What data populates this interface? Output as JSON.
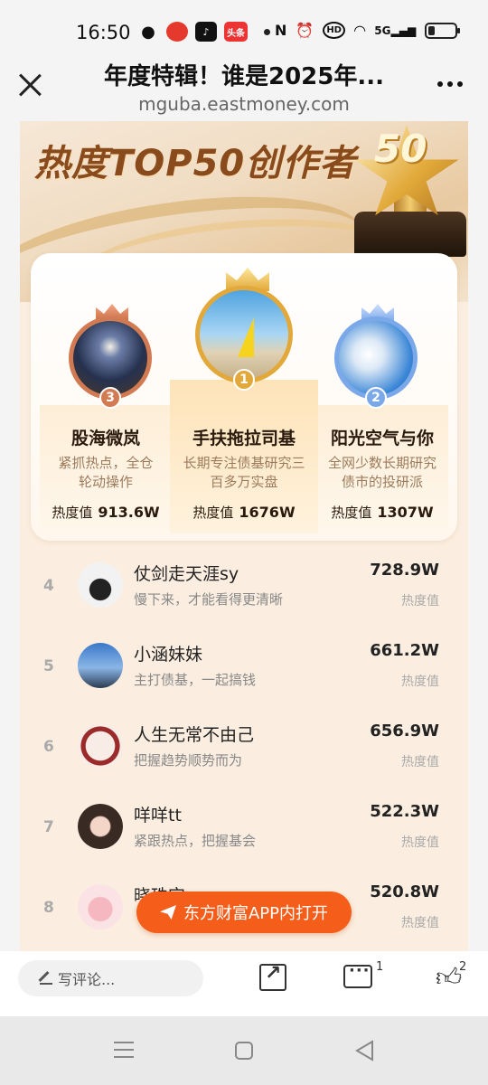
{
  "status_bar": {
    "time": "16:50",
    "toutiao_label": "头条",
    "hd_label": "HD",
    "net_label": "5G",
    "battery_level": 0.25,
    "icons": [
      "wechat-icon",
      "app-icon",
      "tiktok-icon",
      "toutiao-icon",
      "nfc-icon",
      "alarm-icon",
      "hd-icon",
      "wifi-icon",
      "signal-icon",
      "battery-icon"
    ]
  },
  "header": {
    "title": "年度特辑！谁是2025年...",
    "url": "mguba.eastmoney.com"
  },
  "banner": {
    "title": "热度TOP50创作者",
    "trophy_number": "50"
  },
  "podium": [
    {
      "rank": "3",
      "name": "股海微岚",
      "desc": "紧抓热点，全仓轮动操作",
      "heat_label": "热度值",
      "heat": "913.6W"
    },
    {
      "rank": "1",
      "name": "手扶拖拉司基",
      "desc": "长期专注债基研究三百多万实盘",
      "heat_label": "热度值",
      "heat": "1676W"
    },
    {
      "rank": "2",
      "name": "阳光空气与你",
      "desc": "全网少数长期研究债市的投研派",
      "heat_label": "热度值",
      "heat": "1307W"
    }
  ],
  "list": [
    {
      "rank": "4",
      "name": "仗剑走天涯sy",
      "desc": "慢下来，才能看得更清晰",
      "value": "728.9W",
      "unit": "热度值"
    },
    {
      "rank": "5",
      "name": "小涵妹妹",
      "desc": "主打债基，一起搞钱",
      "value": "661.2W",
      "unit": "热度值"
    },
    {
      "rank": "6",
      "name": "人生无常不由己",
      "desc": "把握趋势顺势而为",
      "value": "656.9W",
      "unit": "热度值"
    },
    {
      "rank": "7",
      "name": "咩咩tt",
      "desc": "紧跟热点，把握基会",
      "value": "522.3W",
      "unit": "热度值"
    },
    {
      "rank": "8",
      "name": "晓珠宝",
      "desc": "",
      "value": "520.8W",
      "unit": "热度值"
    }
  ],
  "open_app_button": "东方财富APP内打开",
  "bottom_bar": {
    "comment_placeholder": "写评论...",
    "comment_count": "1",
    "like_count": "2"
  },
  "colors": {
    "accent": "#f45d1a",
    "title_brown": "#8a4b1c",
    "desc_brown": "#9c7b5c",
    "gold": "#e2a93a",
    "bronze": "#d27a52",
    "silver_blue": "#7ba8e8"
  }
}
